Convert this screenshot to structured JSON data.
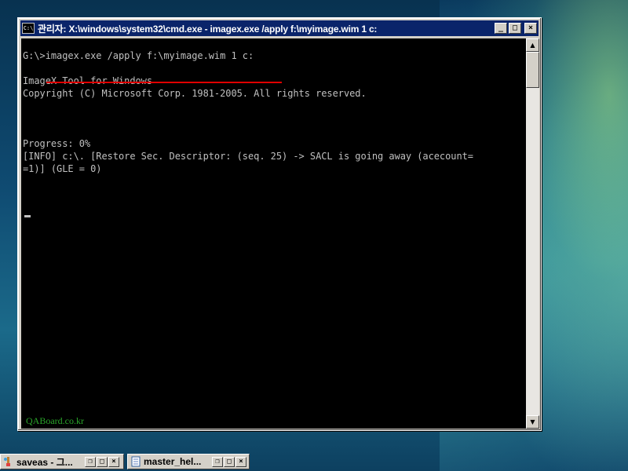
{
  "window": {
    "title": "관리자: X:\\windows\\system32\\cmd.exe - imagex.exe  /apply f:\\myimage.wim 1 c:",
    "icon_label": "C:\\",
    "controls": {
      "minimize": "_",
      "maximize": "□",
      "close": "×"
    }
  },
  "console": {
    "lines": [
      "G:\\>imagex.exe /apply f:\\myimage.wim 1 c:",
      "",
      "ImageX Tool for Windows",
      "Copyright (C) Microsoft Corp. 1981-2005. All rights reserved.",
      "",
      "",
      "",
      "Progress: 0%",
      "[INFO] c:\\. [Restore Sec. Descriptor: (seq. 25) -> SACL is going away (acecount=",
      "=1)] (GLE = 0)"
    ],
    "watermark": "QABoard.co.kr"
  },
  "scrollbar": {
    "up": "▲",
    "down": "▼"
  },
  "taskbar": {
    "items": [
      {
        "label": "saveas - 그...",
        "icon": "paint-icon"
      },
      {
        "label": "master_hel...",
        "icon": "notepad-icon"
      }
    ]
  }
}
